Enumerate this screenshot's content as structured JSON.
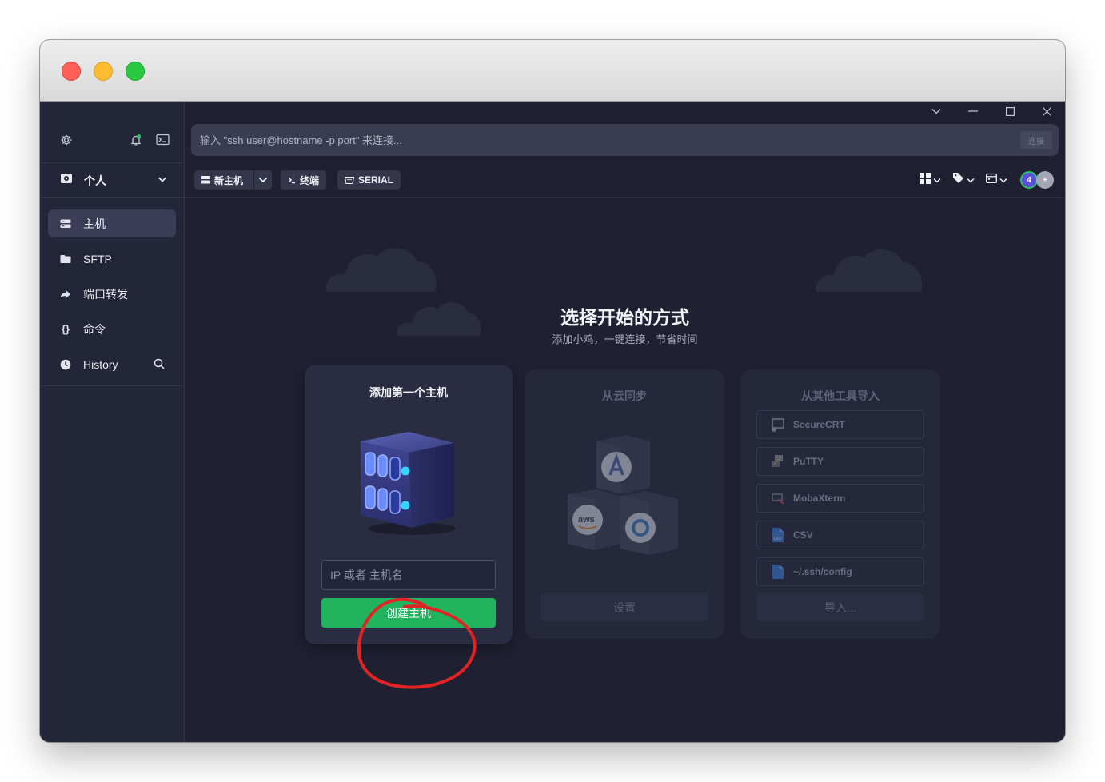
{
  "sidebar": {
    "vault_label": "个人",
    "items": [
      {
        "label": "主机",
        "icon": "server-icon",
        "active": true
      },
      {
        "label": "SFTP",
        "icon": "folder-icon",
        "active": false
      },
      {
        "label": "端口转发",
        "icon": "port-forward-icon",
        "active": false
      },
      {
        "label": "命令",
        "icon": "braces-icon",
        "active": false
      },
      {
        "label": "History",
        "icon": "clock-icon",
        "active": false
      }
    ]
  },
  "command_bar": {
    "placeholder": "输入 \"ssh user@hostname -p port\" 来连接...",
    "connect_label": "连接"
  },
  "toolbar": {
    "new_host_label": "新主机",
    "terminal_label": "终端",
    "serial_label": "SERIAL",
    "avatar_count": "4",
    "avatar_add": "+"
  },
  "hero": {
    "title": "选择开始的方式",
    "subtitle": "添加小鸡，一键连接，节省时间"
  },
  "cards": {
    "add_host": {
      "title": "添加第一个主机",
      "input_placeholder": "IP 或者 主机名",
      "button_label": "创建主机"
    },
    "cloud_sync": {
      "title": "从云同步",
      "button_label": "设置"
    },
    "import": {
      "title": "从其他工具导入",
      "items": [
        "SecureCRT",
        "PuTTY",
        "MobaXterm",
        "CSV",
        "~/.ssh/config"
      ],
      "button_label": "导入..."
    }
  },
  "colors": {
    "accent_green": "#22b35e",
    "annotation_red": "#e02424",
    "background": "#1f2133"
  }
}
